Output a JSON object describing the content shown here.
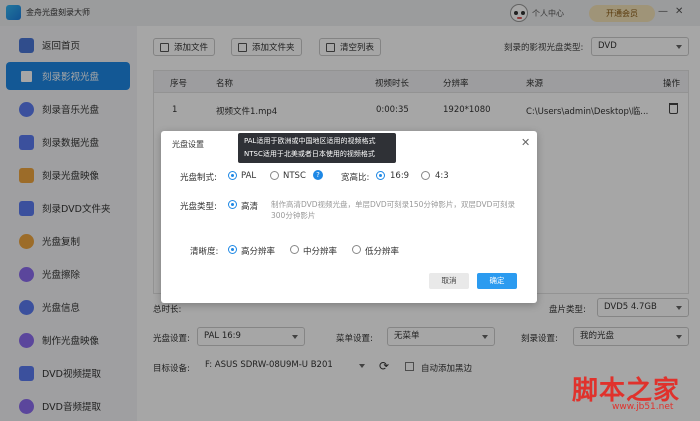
{
  "app": {
    "title": "金舟光盘刻录大师",
    "user_center": "个人中心",
    "vip": "开通会员"
  },
  "sidebar": {
    "items": [
      {
        "label": "返回首页",
        "color": "#4a77d8"
      },
      {
        "label": "刻录影视光盘",
        "color": "#ffffff"
      },
      {
        "label": "刻录音乐光盘",
        "color": "#5b7cf2"
      },
      {
        "label": "刻录数据光盘",
        "color": "#5b7cf2"
      },
      {
        "label": "刻录光盘映像",
        "color": "#f0a640"
      },
      {
        "label": "刻录DVD文件夹",
        "color": "#5b7cf2"
      },
      {
        "label": "光盘复制",
        "color": "#f0a640"
      },
      {
        "label": "光盘擦除",
        "color": "#8c6cf0"
      },
      {
        "label": "光盘信息",
        "color": "#5b7cf2"
      },
      {
        "label": "制作光盘映像",
        "color": "#8c6cf0"
      },
      {
        "label": "DVD视频提取",
        "color": "#5b7cf2"
      },
      {
        "label": "DVD音频提取",
        "color": "#8c6cf0"
      }
    ]
  },
  "toolbar": {
    "add_file": "添加文件",
    "add_folder": "添加文件夹",
    "clear_list": "清空列表",
    "disc_type_label": "刻录的影视光盘类型:",
    "disc_type_value": "DVD"
  },
  "table": {
    "headers": [
      "序号",
      "名称",
      "视频时长",
      "分辨率",
      "来源",
      "操作"
    ],
    "row": {
      "index": "1",
      "name": "视频文件1.mp4",
      "duration": "0:00:35",
      "resolution": "1920*1080",
      "source": "C:\\Users\\admin\\Desktop\\临..."
    }
  },
  "lower": {
    "total_prefix": "总时长:",
    "capacity_label": "盘片类型:",
    "capacity_value": "DVD5 4.7GB",
    "disc_setting_label": "光盘设置:",
    "disc_setting_value": "PAL 16:9",
    "menu_setting_label": "菜单设置:",
    "menu_setting_value": "无菜单",
    "burn_setting_label": "刻录设置:",
    "burn_setting_value": "我的光盘",
    "target_label": "目标设备:",
    "target_value": "F: ASUS SDRW-08U9M-U B201",
    "auto_black": "自动添加黑边"
  },
  "dialog": {
    "title": "光盘设置",
    "format_label": "光盘制式:",
    "pal": "PAL",
    "ntsc": "NTSC",
    "help": "?",
    "aspect_label": "宽高比:",
    "ratio_169": "16:9",
    "ratio_43": "4:3",
    "type_label": "光盘类型:",
    "type_hd": "高清",
    "type_desc": "制作高清DVD视频光盘，单层DVD可刻录150分钟影片，双层DVD可刻录300分钟影片",
    "clarity_label": "清晰度:",
    "high": "高分辨率",
    "mid": "中分辨率",
    "low": "低分辨率",
    "cancel": "取消",
    "ok": "确定"
  },
  "tooltip": {
    "line1": "PAL适用于欧洲或中国地区适用的视频格式",
    "line2": "NTSC适用于北美或者日本使用的视频格式"
  },
  "watermark": {
    "text": "脚本之家",
    "url": "www.jb51.net"
  }
}
